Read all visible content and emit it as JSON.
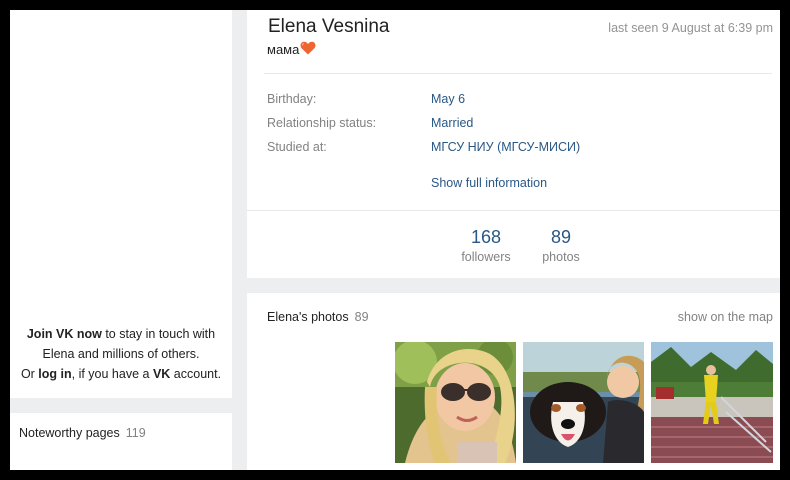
{
  "sidebar": {
    "join_strong": "Join VK now",
    "join_rest": " to stay in touch with",
    "join_line2": "Elena and millions of others.",
    "login_pre": "Or ",
    "login_link": "log in",
    "login_mid": ", if you have a ",
    "login_vk": "VK",
    "login_post": " account.",
    "noteworthy_label": "Noteworthy pages",
    "noteworthy_count": "119"
  },
  "profile": {
    "name": "Elena Vesnina",
    "status": "мама",
    "last_seen": "last seen 9 August at 6:39 pm",
    "info": [
      {
        "label": "Birthday:",
        "value": "May 6"
      },
      {
        "label": "Relationship status:",
        "value": "Married"
      },
      {
        "label": "Studied at:",
        "value": "МГСУ НИУ (МГСУ-МИСИ)"
      }
    ],
    "show_full": "Show full information",
    "stats": [
      {
        "num": "168",
        "label": "followers"
      },
      {
        "num": "89",
        "label": "photos"
      }
    ]
  },
  "photos": {
    "title": "Elena's photos",
    "count": "89",
    "map_link": "show on the map"
  },
  "icons": {
    "status_emoji": "heart-icon"
  },
  "colors": {
    "link": "#2a5885",
    "muted": "#828282",
    "background": "#edeef0"
  }
}
